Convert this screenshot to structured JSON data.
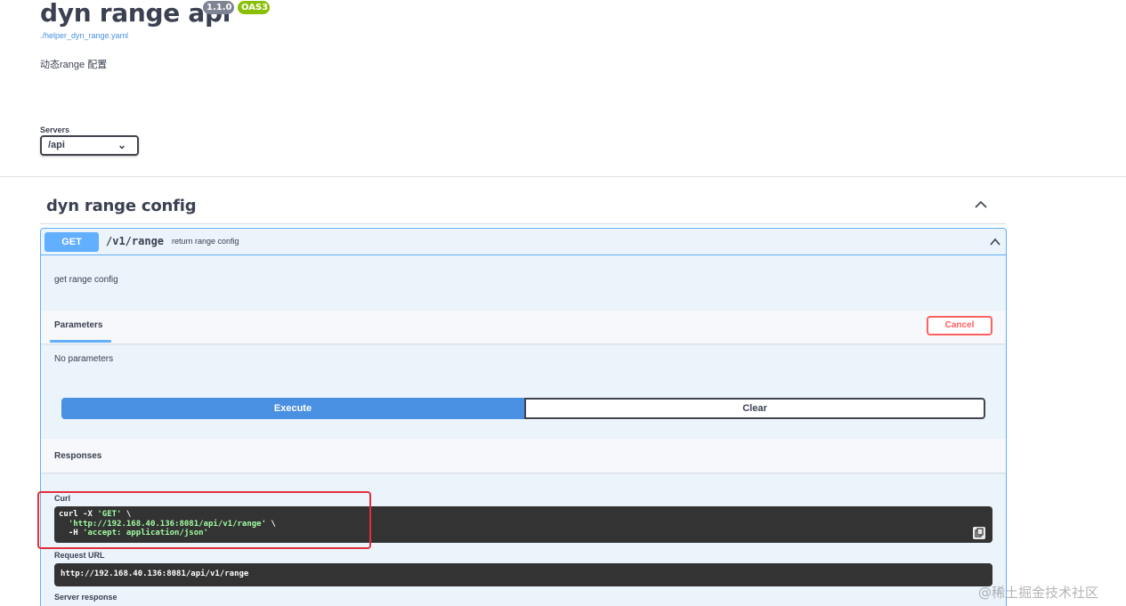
{
  "info": {
    "title": "dyn range api",
    "version": "1.1.0",
    "oas": "OAS3",
    "spec_link": "./helper_dyn_range.yaml",
    "description": "动态range 配置"
  },
  "servers": {
    "label": "Servers",
    "selected": "/api"
  },
  "tag": {
    "name": "dyn range config"
  },
  "operation": {
    "method": "GET",
    "path": "/v1/range",
    "summary": "return range config",
    "description": "get range config",
    "parameters_title": "Parameters",
    "cancel_label": "Cancel",
    "no_params": "No parameters",
    "execute_label": "Execute",
    "clear_label": "Clear",
    "responses_title": "Responses",
    "curl_label": "Curl",
    "curl": {
      "line1_cmd": "curl -X ",
      "line1_method": "'GET'",
      "line1_tail": " \\",
      "line2_indent": "  ",
      "line2_url": "'http://192.168.40.136:8081/api/v1/range'",
      "line2_tail": " \\",
      "line3_flag": "  -H ",
      "line3_header": "'accept: application/json'"
    },
    "request_url_label": "Request URL",
    "request_url": "http://192.168.40.136:8081/api/v1/range",
    "server_response_label": "Server response"
  },
  "watermark": "@稀土掘金技术社区",
  "colors": {
    "get_blue": "#61affe",
    "execute_blue": "#4990e2",
    "cancel_red": "#ff6060",
    "oas_green": "#89bf04",
    "highlight_red": "#e0303a"
  }
}
